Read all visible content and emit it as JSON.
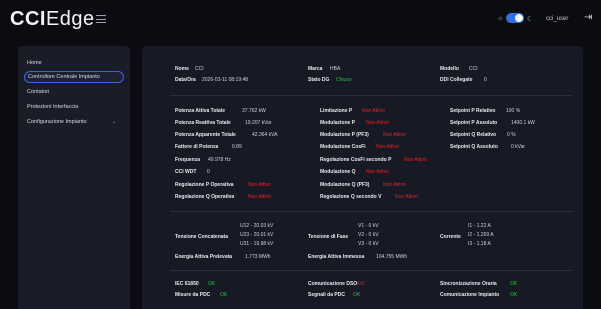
{
  "app": {
    "logo_bold": "CCI",
    "logo_light": "Edge"
  },
  "header": {
    "user": "cci_user",
    "theme_light_icon": "☼",
    "theme_dark_icon": "☾",
    "logout_icon": "⇥"
  },
  "sidebar": {
    "items": [
      {
        "label": "Home",
        "active": false
      },
      {
        "label": "Controllore Centrale Impianto",
        "active": true
      },
      {
        "label": "Contatori",
        "active": false
      },
      {
        "label": "Protezioni Interfaccia",
        "active": false
      },
      {
        "label": "Configurazione Impianto",
        "active": false,
        "has_submenu": true
      }
    ],
    "chevron": "⌄"
  },
  "info": {
    "nome_label": "Nome",
    "nome_value": "CCI",
    "marca_label": "Marca",
    "marca_value": "HBA",
    "modello_label": "Modello",
    "modello_value": "CCI",
    "dataora_label": "Data/Ora",
    "dataora_value": "2026-03-11 08:19:48",
    "statodg_label": "Stato DG",
    "statodg_value": "Chiuso",
    "ddi_label": "DDI Collegate",
    "ddi_value": "0"
  },
  "measures": {
    "col1": [
      {
        "label": "Potenza Attiva Totale",
        "value": "37.762 kW",
        "status": "normal"
      },
      {
        "label": "Potenza Reattiva Totale",
        "value": "19.207 kVar",
        "status": "normal"
      },
      {
        "label": "Potenza Apparente Totale",
        "value": "42.364 kVA",
        "status": "normal"
      },
      {
        "label": "Fattore di Potenza",
        "value": "0.89",
        "status": "normal"
      },
      {
        "label": "Frequenza",
        "value": "49.978 Hz",
        "status": "normal"
      },
      {
        "label": "CCI WDT",
        "value": "0",
        "status": "normal"
      },
      {
        "label": "Regolazione P Operativa",
        "value": "Non Attivo",
        "status": "red"
      },
      {
        "label": "Regolazione Q Operativa",
        "value": "Non Attivo",
        "status": "red"
      }
    ],
    "col2": [
      {
        "label": "Limitazione P",
        "value": "Non Attivo"
      },
      {
        "label": "Modulazione P",
        "value": "Non Attivo"
      },
      {
        "label": "Modulazione P (PF3)",
        "value": "Non Attivo"
      },
      {
        "label": "Modulazione CosFi",
        "value": "Non Attivo"
      },
      {
        "label": "Regolazione CosFi secondo P",
        "value": "Non Attivo"
      },
      {
        "label": "Modulazione Q",
        "value": "Non Attivo"
      },
      {
        "label": "Modulazione Q (PF3)",
        "value": "Non Attivo"
      },
      {
        "label": "Regolazione Q secondo V",
        "value": "Non Attivo"
      }
    ],
    "col3": [
      {
        "label": "Setpoint P Relativo",
        "value": "100 %"
      },
      {
        "label": "Setpoint P Assoluto",
        "value": "1400.1 kW"
      },
      {
        "label": "Setpoint Q Relativo",
        "value": "0 %"
      },
      {
        "label": "Setpoint Q Assoluto",
        "value": "0 kVar"
      }
    ]
  },
  "electrical": {
    "tensione_concatenata_label": "Tensione Concatenata",
    "u12": "U12 - 20.03 kV",
    "u23": "U23 - 20.01 kV",
    "u31": "U31 - 19.98 kV",
    "tensione_fase_label": "Tensione di Fase",
    "v1": "V1 - 0 kV",
    "v2": "V2 - 0 kV",
    "v3": "V3 - 0 kV",
    "corrente_label": "Corrente",
    "i1": "I1 - 1.22 A",
    "i2": "I2 - 1.269 A",
    "i3": "I3 - 1.18 A",
    "energia_prelevata_label": "Energia Attiva Prelevata",
    "energia_prelevata_value": "1.773 MWh",
    "energia_immessa_label": "Energia Attiva Immessa",
    "energia_immessa_value": "104.755 MWh"
  },
  "comms": {
    "iec_label": "IEC 61850",
    "iec_value": "OK",
    "dso_label": "Comunicazione DSO",
    "dso_value": "KO",
    "sync_label": "Sincronizzazione Oraria",
    "sync_value": "OK",
    "pdc_label": "Misure da PDC",
    "pdc_value": "OK",
    "segnali_label": "Segnali da PDC",
    "segnali_value": "OK",
    "impianto_label": "Comunicazione Impianto",
    "impianto_value": "OK"
  },
  "colors": {
    "ok": "#27c13f",
    "ko": "#e0242a",
    "accent": "#2f6fe8",
    "panel": "#171a24",
    "background": "#0a0c12"
  }
}
